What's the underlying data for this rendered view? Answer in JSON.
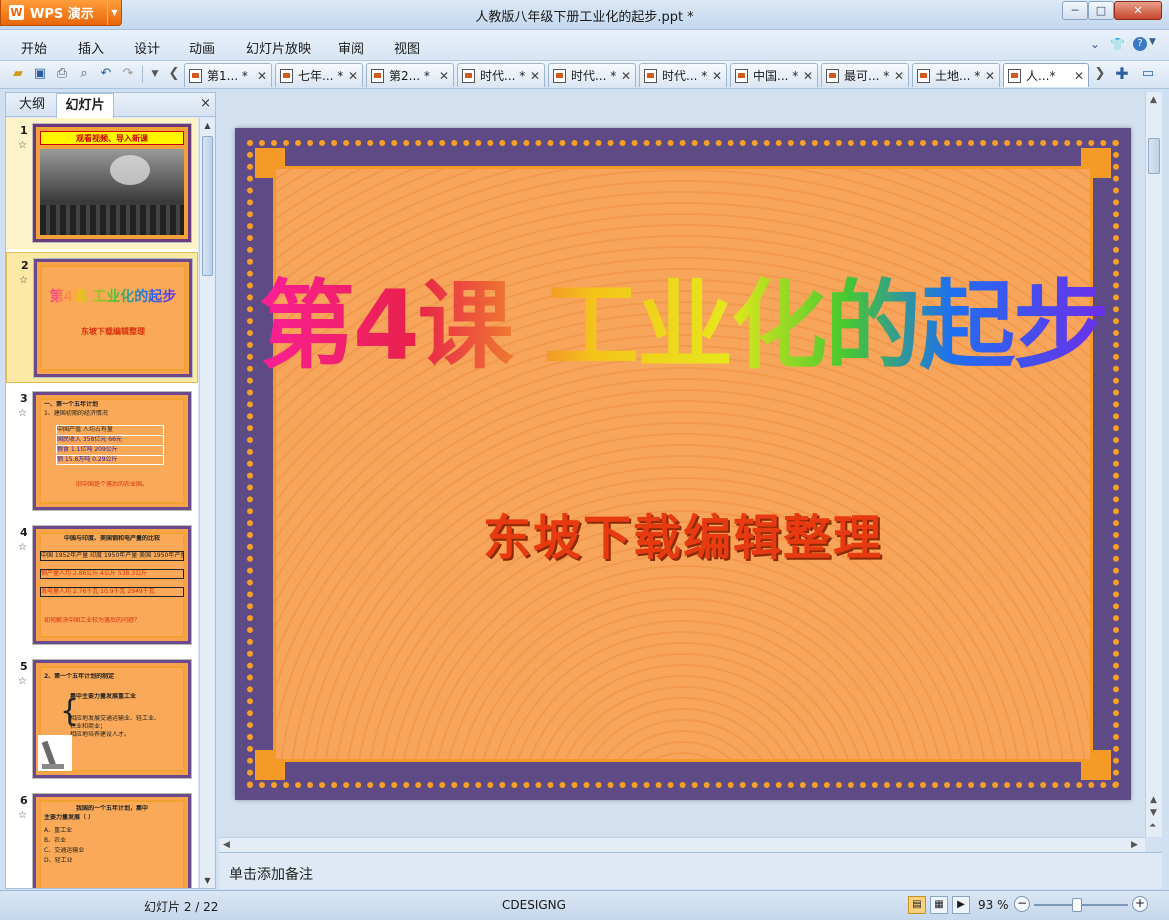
{
  "window": {
    "app_name": "WPS 演示",
    "app_logo": "W",
    "title": "人教版八年级下册工业化的起步.ppt *",
    "controls": [
      "─",
      "□",
      "✕"
    ]
  },
  "menu": {
    "items": [
      "开始",
      "插入",
      "设计",
      "动画",
      "幻灯片放映",
      "审阅",
      "视图"
    ],
    "right_icons": [
      "chevron-down-icon",
      "shirt-icon",
      "help-icon"
    ]
  },
  "tabs": [
    {
      "label": "第1... *",
      "active": false
    },
    {
      "label": "七年... *",
      "active": false
    },
    {
      "label": "第2... *",
      "active": false
    },
    {
      "label": "时代... *",
      "active": false
    },
    {
      "label": "时代... *",
      "active": false
    },
    {
      "label": "时代... *",
      "active": false
    },
    {
      "label": "中国... *",
      "active": false
    },
    {
      "label": "最可... *",
      "active": false
    },
    {
      "label": "土地... *",
      "active": false
    },
    {
      "label": "人...*",
      "active": true
    }
  ],
  "left_panel": {
    "tab_outline": "大纲",
    "tab_slides": "幻灯片",
    "close": "×",
    "thumbnails": [
      {
        "num": "1",
        "lines": [
          "观看视频、导入新课"
        ]
      },
      {
        "num": "2",
        "lines": [
          "第4课 工业化的起步",
          "东坡下载编辑整理"
        ]
      },
      {
        "num": "3",
        "lines": [
          "一、第一个五年计划",
          "1、建国初期的经济情况",
          "中国产值 人均占有量",
          "国民收入 358亿元 66元",
          "粮食 1.1亿吨 209公斤",
          "钢 15.8万吨 0.29公斤",
          "旧中国是个落后的农业国。"
        ]
      },
      {
        "num": "4",
        "lines": [
          "中国与印度、美国钢和电产量的比较",
          "中国 1952年产量 印度 1950年产量 美国 1950年产量",
          "钢产量人均 2.86公斤 4公斤 538.3公斤",
          "发电量人均 2.76千瓦 10.9千瓦 2949千瓦",
          "如何解决中国工业较为落后的问题？"
        ]
      },
      {
        "num": "5",
        "lines": [
          "2、第一个五年计划的制定",
          "集中主要力量发展重工业",
          "相应地发展交通运输业、轻工业、",
          "农业和商业；",
          "相应地培养建设人才。"
        ]
      },
      {
        "num": "6",
        "lines": [
          "我国的一个五年计划，集中",
          "主要力量发展（  ）",
          "A、重工业",
          "B、农业",
          "C、交通运输业",
          "D、轻工业"
        ]
      }
    ]
  },
  "slide": {
    "title": "第4课  工业化的起步",
    "subtitle": "东坡下载编辑整理"
  },
  "notes_placeholder": "单击添加备注",
  "status": {
    "slide_counter": "幻灯片 2 / 22",
    "theme": "CDESIGNG",
    "zoom_label": "93 %",
    "zoom_value_percent": 93
  }
}
